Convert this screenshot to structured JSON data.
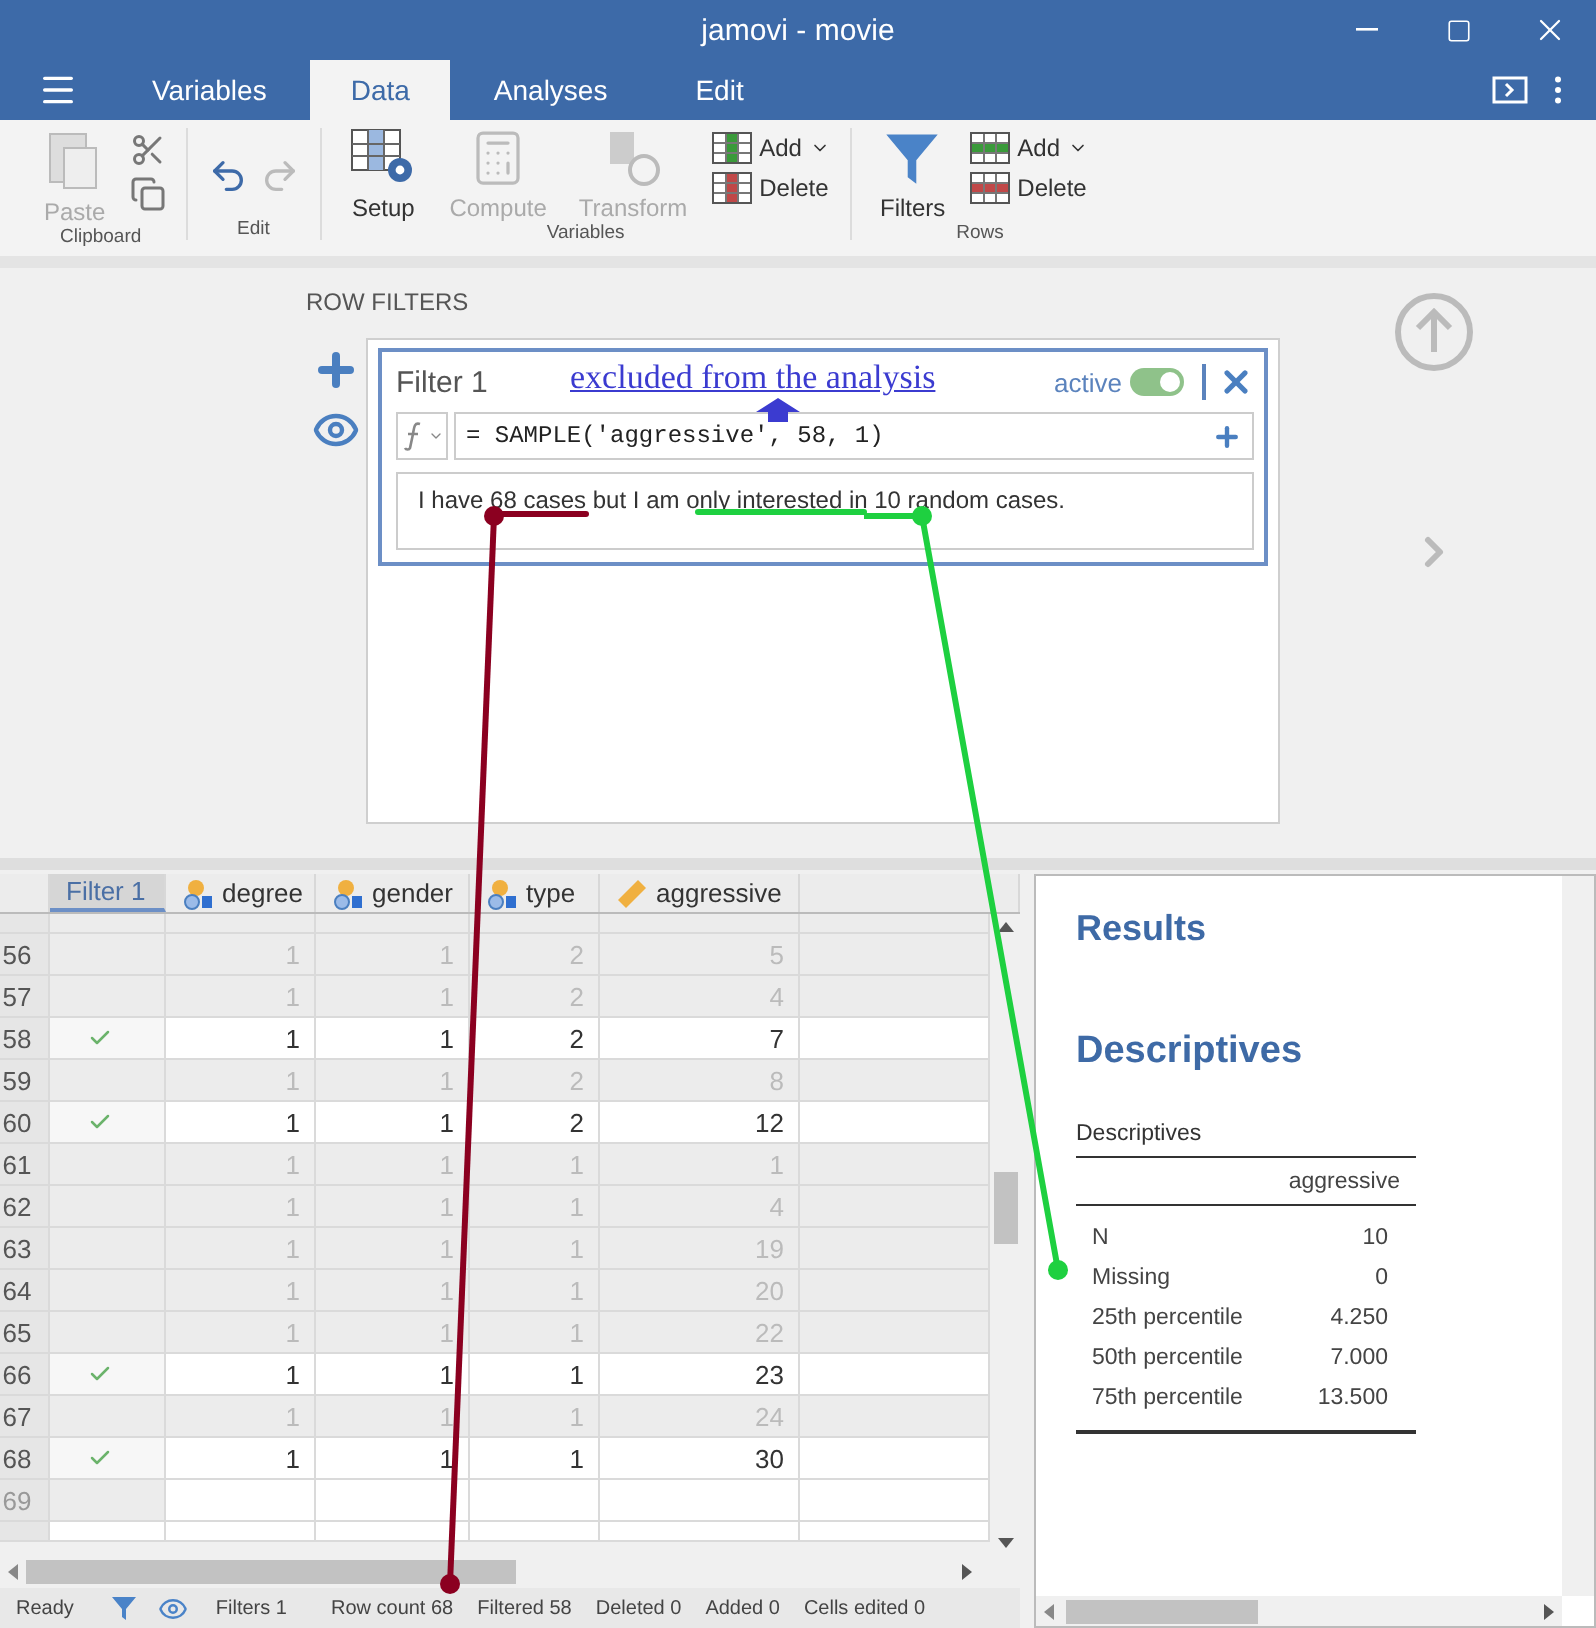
{
  "window": {
    "title": "jamovi - movie"
  },
  "menu_tabs": [
    {
      "label": "Variables",
      "selected": false
    },
    {
      "label": "Data",
      "selected": true
    },
    {
      "label": "Analyses",
      "selected": false
    },
    {
      "label": "Edit",
      "selected": false
    }
  ],
  "ribbon": [
    {
      "label": "Clipboard",
      "tools": [
        {
          "kind": "large",
          "label": "Paste",
          "disabled": true
        },
        {
          "kind": "stack",
          "items": [
            {
              "disabled": false
            },
            {
              "disabled": false
            }
          ]
        }
      ]
    },
    {
      "label": "Edit",
      "tools": [
        {
          "kind": "pair",
          "items": [
            {
              "disabled": false
            },
            {
              "disabled": true
            }
          ]
        }
      ]
    },
    {
      "label": "Variables",
      "tools": [
        {
          "kind": "large",
          "label": "Setup",
          "disabled": false
        },
        {
          "kind": "large",
          "label": "Compute",
          "disabled": true
        },
        {
          "kind": "large",
          "label": "Transform",
          "disabled": true
        },
        {
          "kind": "stack",
          "items": [
            {
              "label": "Add",
              "dropdown": true,
              "disabled": false
            },
            {
              "label": "Delete",
              "dropdown": false,
              "disabled": false
            }
          ]
        }
      ]
    },
    {
      "label": "Rows",
      "tools": [
        {
          "kind": "large",
          "label": "Filters",
          "disabled": false
        },
        {
          "kind": "stack",
          "items": [
            {
              "label": "Add",
              "dropdown": true,
              "disabled": false
            },
            {
              "label": "Delete",
              "dropdown": false,
              "disabled": false
            }
          ]
        }
      ]
    }
  ],
  "section_label": "ROW FILTERS",
  "filter": {
    "name": "Filter 1",
    "active_label": "active",
    "active": true,
    "formula": "= SAMPLE('aggressive', 58, 1)",
    "description": "I have 68 cases but I am only interested in 10 random cases."
  },
  "annotation": {
    "note": "excluded from the analysis"
  },
  "grid": {
    "columns": [
      {
        "label": "Filter 1",
        "kind": "filter"
      },
      {
        "label": "degree",
        "kind": "nominal"
      },
      {
        "label": "gender",
        "kind": "nominal"
      },
      {
        "label": "type",
        "kind": "nominal"
      },
      {
        "label": "aggressive",
        "kind": "continuous"
      }
    ],
    "rows": [
      {
        "number": "56",
        "kind": "data",
        "included": false,
        "cells": [
          "1",
          "1",
          "2",
          "5"
        ]
      },
      {
        "number": "57",
        "kind": "data",
        "included": false,
        "cells": [
          "1",
          "1",
          "2",
          "4"
        ]
      },
      {
        "number": "58",
        "kind": "data",
        "included": true,
        "cells": [
          "1",
          "1",
          "2",
          "7"
        ]
      },
      {
        "number": "59",
        "kind": "data",
        "included": false,
        "cells": [
          "1",
          "1",
          "2",
          "8"
        ]
      },
      {
        "number": "60",
        "kind": "data",
        "included": true,
        "cells": [
          "1",
          "1",
          "2",
          "12"
        ]
      },
      {
        "number": "61",
        "kind": "data",
        "included": false,
        "cells": [
          "1",
          "1",
          "1",
          "1"
        ]
      },
      {
        "number": "62",
        "kind": "data",
        "included": false,
        "cells": [
          "1",
          "1",
          "1",
          "4"
        ]
      },
      {
        "number": "63",
        "kind": "data",
        "included": false,
        "cells": [
          "1",
          "1",
          "1",
          "19"
        ]
      },
      {
        "number": "64",
        "kind": "data",
        "included": false,
        "cells": [
          "1",
          "1",
          "1",
          "20"
        ]
      },
      {
        "number": "65",
        "kind": "data",
        "included": false,
        "cells": [
          "1",
          "1",
          "1",
          "22"
        ]
      },
      {
        "number": "66",
        "kind": "data",
        "included": true,
        "cells": [
          "1",
          "1",
          "1",
          "23"
        ]
      },
      {
        "number": "67",
        "kind": "data",
        "included": false,
        "cells": [
          "1",
          "1",
          "1",
          "24"
        ]
      },
      {
        "number": "68",
        "kind": "data",
        "included": true,
        "cells": [
          "1",
          "1",
          "1",
          "30"
        ]
      },
      {
        "number": "69",
        "kind": "blank"
      }
    ]
  },
  "status_bar": {
    "ready": "Ready",
    "filters": "Filters 1",
    "counts": [
      "Row count 68",
      "Filtered 58",
      "Deleted 0",
      "Added 0",
      "Cells edited 0"
    ]
  },
  "results": {
    "title": "Results",
    "heading": "Descriptives",
    "table": {
      "caption": "Descriptives",
      "column": "aggressive",
      "rows": [
        {
          "label": "N",
          "value": "10"
        },
        {
          "label": "Missing",
          "value": "0"
        },
        {
          "label": "25th percentile",
          "value": "4.250"
        },
        {
          "label": "50th percentile",
          "value": "7.000"
        },
        {
          "label": "75th percentile",
          "value": "13.500"
        }
      ]
    }
  }
}
